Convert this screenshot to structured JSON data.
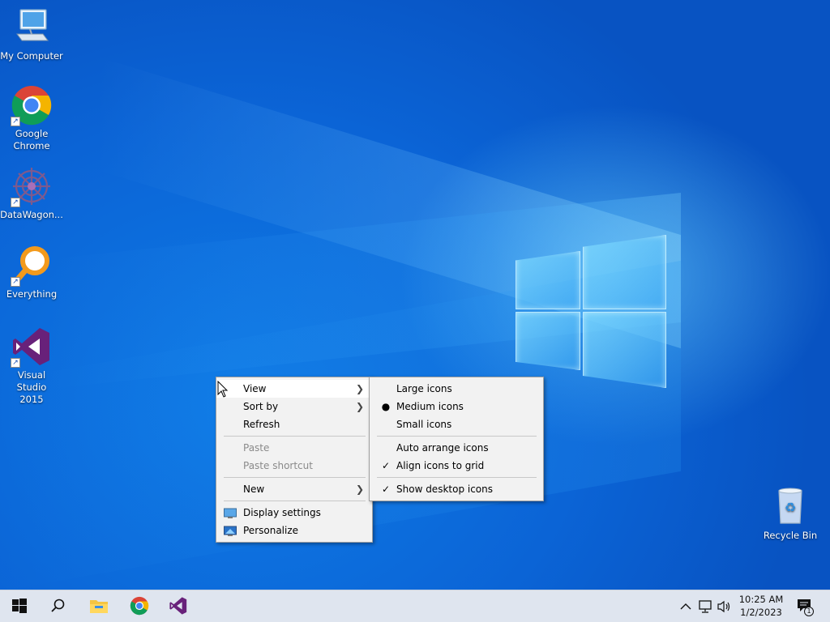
{
  "desktop_icons": [
    {
      "label": "My Computer",
      "icon": "computer-icon",
      "shortcut": false
    },
    {
      "label": "Google Chrome",
      "icon": "chrome-icon",
      "shortcut": true
    },
    {
      "label": "DataWagon...",
      "icon": "datawagon-icon",
      "shortcut": true
    },
    {
      "label": "Everything",
      "icon": "everything-search-icon",
      "shortcut": true
    },
    {
      "label": "Visual Studio 2015",
      "icon": "visual-studio-icon",
      "shortcut": true
    },
    {
      "label": "Recycle Bin",
      "icon": "recycle-bin-icon",
      "shortcut": false
    }
  ],
  "context_menu": {
    "items": [
      {
        "label": "View",
        "submenu": true,
        "highlighted": true
      },
      {
        "label": "Sort by",
        "submenu": true
      },
      {
        "label": "Refresh"
      },
      {
        "label": "Paste",
        "disabled": true
      },
      {
        "label": "Paste shortcut",
        "disabled": true
      },
      {
        "label": "New",
        "submenu": true
      },
      {
        "label": "Display settings",
        "icon": "display-icon"
      },
      {
        "label": "Personalize",
        "icon": "personalize-icon"
      }
    ]
  },
  "view_submenu": {
    "items": [
      {
        "label": "Large icons"
      },
      {
        "label": "Medium icons",
        "selected": true
      },
      {
        "label": "Small icons"
      },
      {
        "label": "Auto arrange icons"
      },
      {
        "label": "Align icons to grid",
        "checked": true
      },
      {
        "label": "Show desktop icons",
        "checked": true
      }
    ]
  },
  "taskbar": {
    "pinned": [
      "start-icon",
      "search-icon",
      "file-explorer-icon",
      "chrome-icon",
      "visual-studio-icon"
    ],
    "tray": [
      "chevron-up-icon",
      "network-icon",
      "volume-icon"
    ],
    "time": "10:25 AM",
    "date": "1/2/2023",
    "notification_count": "1"
  },
  "colors": {
    "wallpaper": "#0b64d6",
    "taskbar": "#dfe5ef",
    "menu_bg": "#f2f2f2",
    "vs_purple": "#68217a",
    "everything_orange": "#f39a1c"
  }
}
